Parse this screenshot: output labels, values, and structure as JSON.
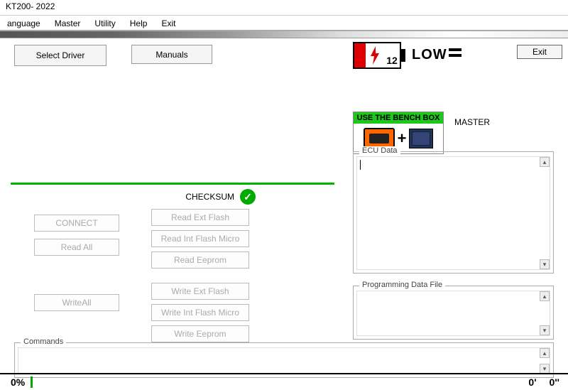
{
  "window": {
    "title": "KT200- 2022"
  },
  "menu": {
    "items": [
      "anguage",
      "Master",
      "Utility",
      "Help",
      "Exit"
    ]
  },
  "toolbar": {
    "select_driver": "Select Driver",
    "manuals": "Manuals",
    "exit": "Exit"
  },
  "battery": {
    "number": "12",
    "status": "LOW"
  },
  "bench": {
    "title": "USE THE BENCH BOX"
  },
  "role_label": "MASTER",
  "checksum": {
    "label": "CHECKSUM"
  },
  "ops": {
    "connect": "CONNECT",
    "read_all": "Read All",
    "write_all": "WriteAll",
    "read_ext_flash": "Read Ext Flash",
    "read_int_flash_micro": "Read Int Flash Micro",
    "read_eeprom": "Read Eeprom",
    "write_ext_flash": "Write Ext Flash",
    "write_int_flash_micro": "Write Int Flash Micro",
    "write_eeprom": "Write Eeprom"
  },
  "groups": {
    "ecu_data": "ECU Data",
    "programming_data_file": "Programming Data File",
    "commands": "Commands"
  },
  "status": {
    "percent": "0%",
    "t1": "0'",
    "t2": "0''"
  }
}
